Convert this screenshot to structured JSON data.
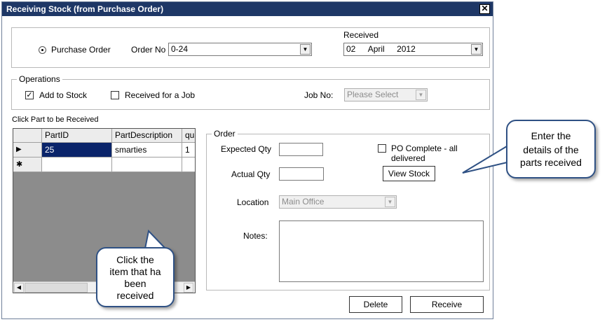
{
  "window": {
    "title": "Receiving Stock (from Purchase Order)",
    "close_glyph": "✕"
  },
  "top": {
    "purchase_order_label": "Purchase Order",
    "order_no_label": "Order No",
    "order_no_value": "0-24",
    "received_label": "Received",
    "received_day": "02",
    "received_month": "April",
    "received_year": "2012"
  },
  "operations": {
    "legend": "Operations",
    "add_to_stock_label": "Add to Stock",
    "add_to_stock_checked": "✓",
    "received_for_job_label": "Received for a  Job",
    "job_no_label": "Job No:",
    "job_no_placeholder": "Please Select"
  },
  "parts": {
    "caption": "Click Part to be Received",
    "columns": [
      "PartID",
      "PartDescription",
      "qu"
    ],
    "rows": [
      {
        "marker": "▶",
        "part_id": "25",
        "description": "smarties",
        "qty": "1"
      }
    ],
    "new_row_marker": "✱"
  },
  "order": {
    "legend": "Order",
    "expected_qty_label": "Expected Qty",
    "actual_qty_label": "Actual Qty",
    "po_complete_label": "PO Complete - all delivered",
    "view_stock_label": "View Stock",
    "location_label": "Location",
    "location_value": "Main Office",
    "notes_label": "Notes:"
  },
  "buttons": {
    "delete_label": "Delete",
    "receive_label": "Receive"
  },
  "callouts": {
    "right": [
      "Enter the",
      "details of the",
      "parts received"
    ],
    "left": [
      "Click the",
      "item that ha",
      "been",
      "received"
    ]
  },
  "colors": {
    "title_bar": "#1e3766",
    "selection": "#0a246a",
    "grid_background": "#8c8c8c",
    "callout_border": "#2f5184"
  },
  "icons": {
    "dropdown": "chevron-down-icon",
    "row_marker": "triangle-right-icon",
    "new_row": "asterisk-icon",
    "close": "close-icon"
  }
}
